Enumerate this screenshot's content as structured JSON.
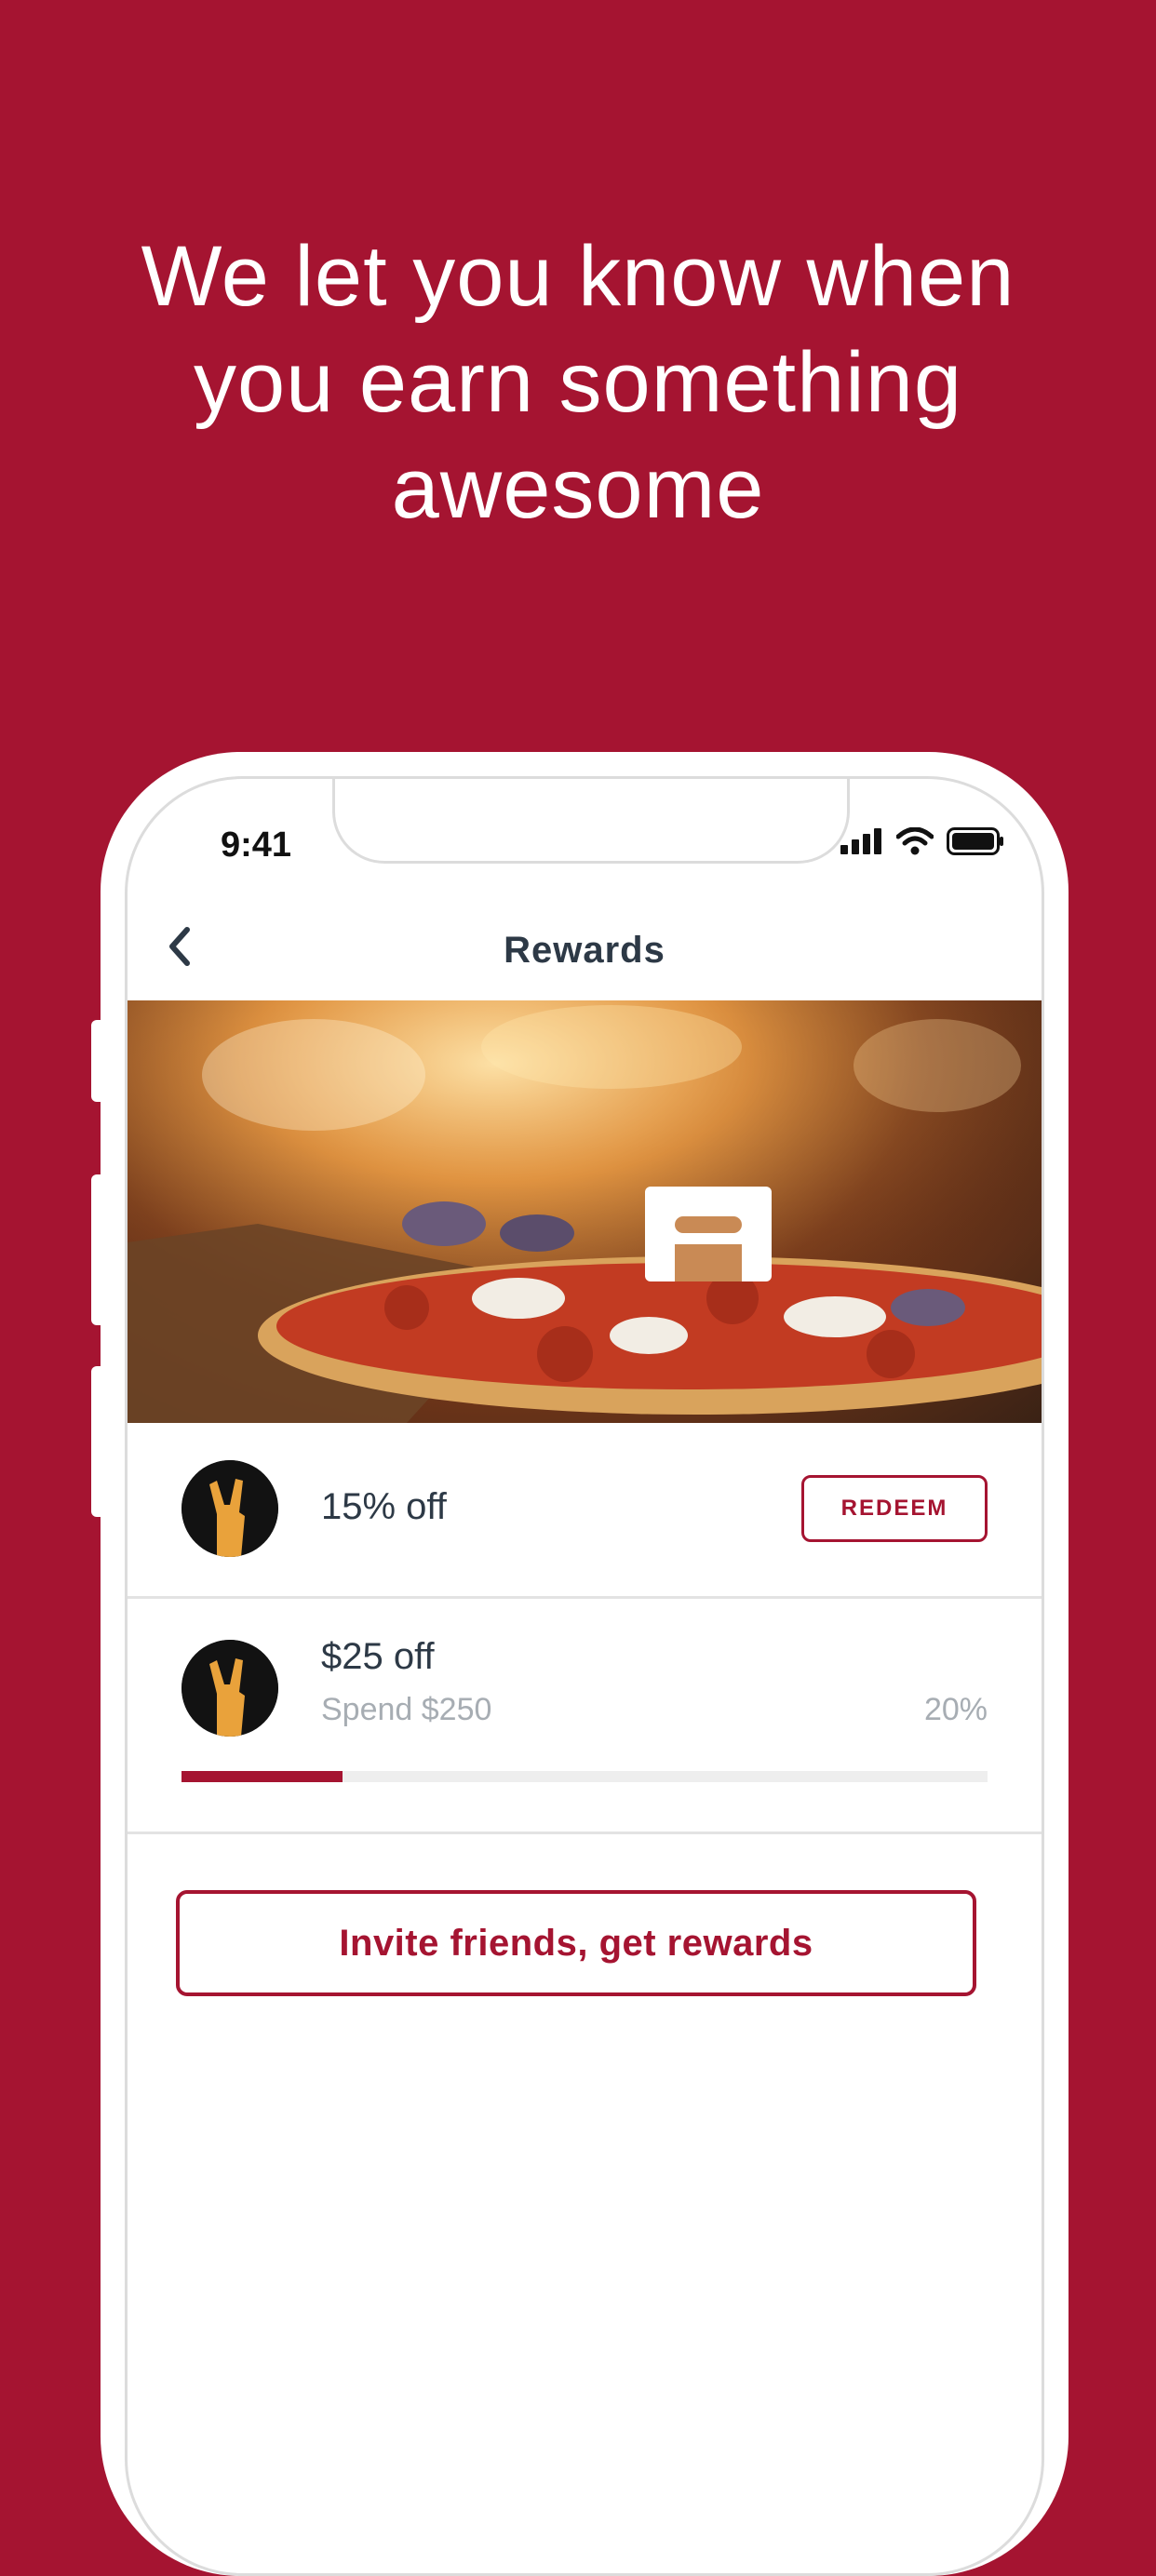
{
  "headline": {
    "line1": "We let you know when",
    "line2": "you earn something",
    "line3": "awesome"
  },
  "status_bar": {
    "time": "9:41",
    "icons": [
      "cellular-signal-icon",
      "wifi-icon",
      "battery-icon"
    ]
  },
  "nav": {
    "back_icon": "chevron-left-icon",
    "title": "Rewards"
  },
  "rewards": [
    {
      "icon": "rock-hand-badge-icon",
      "title": "15% off",
      "action_label": "REDEEM"
    },
    {
      "icon": "rock-hand-badge-icon",
      "title": "$25 off",
      "subtitle": "Spend $250",
      "progress_label": "20%",
      "progress_value": 0.2
    }
  ],
  "invite_button_label": "Invite friends, get rewards",
  "colors": {
    "brand": "#a51431",
    "text_dark": "#2d3946",
    "text_muted": "#a7adb3",
    "badge_hand": "#e9a23b"
  }
}
